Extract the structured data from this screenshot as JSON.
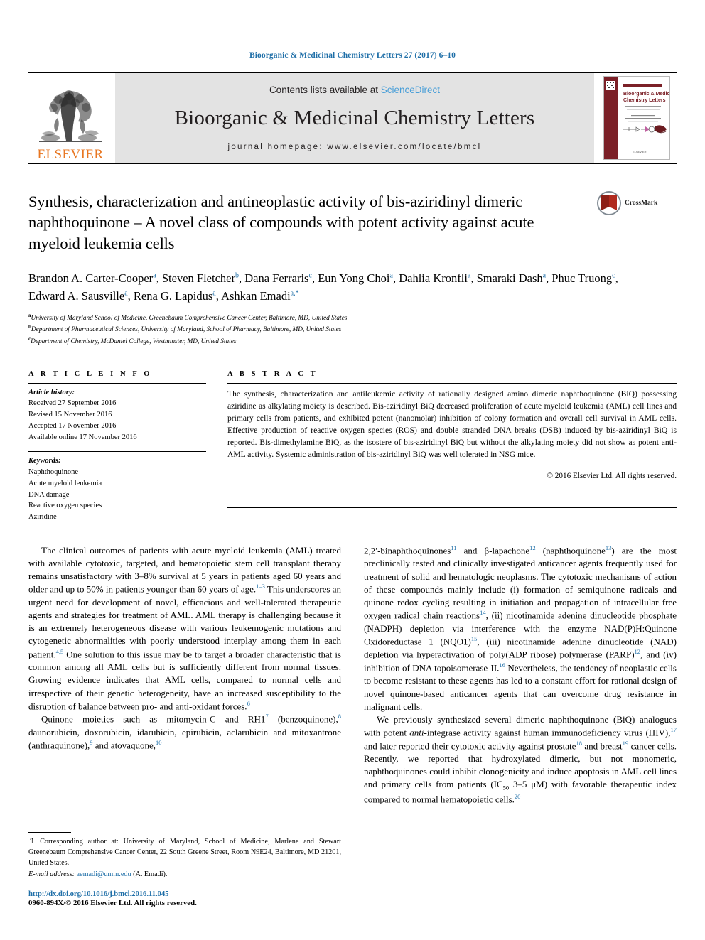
{
  "running_head": "Bioorganic & Medicinal Chemistry Letters 27 (2017) 6–10",
  "masthead": {
    "publisher": "ELSEVIER",
    "contents_prefix": "Contents lists available at ",
    "contents_link": "ScienceDirect",
    "journal_title": "Bioorganic & Medicinal Chemistry Letters",
    "homepage": "journal homepage: www.elsevier.com/locate/bmcl",
    "cover_title": "Bioorganic & Medicinal Chemistry Letters"
  },
  "badge": {
    "crossmark_label": "CrossMark"
  },
  "article": {
    "title": "Synthesis, characterization and antineoplastic activity of bis-aziridinyl dimeric naphthoquinone – A novel class of compounds with potent activity against acute myeloid leukemia cells",
    "authors": [
      {
        "name": "Brandon A. Carter-Cooper",
        "sup": "a"
      },
      {
        "name": "Steven Fletcher",
        "sup": "b"
      },
      {
        "name": "Dana Ferraris",
        "sup": "c"
      },
      {
        "name": "Eun Yong Choi",
        "sup": "a"
      },
      {
        "name": "Dahlia Kronfli",
        "sup": "a"
      },
      {
        "name": "Smaraki Dash",
        "sup": "a"
      },
      {
        "name": "Phuc Truong",
        "sup": "c"
      },
      {
        "name": "Edward A. Sausville",
        "sup": "a"
      },
      {
        "name": "Rena G. Lapidus",
        "sup": "a"
      },
      {
        "name": "Ashkan Emadi",
        "sup": "a,*"
      }
    ],
    "affiliations": [
      {
        "marker": "a",
        "text": "University of Maryland School of Medicine, Greenebaum Comprehensive Cancer Center, Baltimore, MD, United States"
      },
      {
        "marker": "b",
        "text": "Department of Pharmaceutical Sciences, University of Maryland, School of Pharmacy, Baltimore, MD, United States"
      },
      {
        "marker": "c",
        "text": "Department of Chemistry, McDaniel College, Westminster, MD, United States"
      }
    ]
  },
  "article_info": {
    "heading": "A R T I C L E   I N F O",
    "history_label": "Article history:",
    "history": [
      "Received 27 September 2016",
      "Revised 15 November 2016",
      "Accepted 17 November 2016",
      "Available online 17 November 2016"
    ],
    "keywords_label": "Keywords:",
    "keywords": [
      "Naphthoquinone",
      "Acute myeloid leukemia",
      "DNA damage",
      "Reactive oxygen species",
      "Aziridine"
    ]
  },
  "abstract": {
    "heading": "A B S T R A C T",
    "text": "The synthesis, characterization and antileukemic activity of rationally designed amino dimeric naphthoquinone (BiQ) possessing aziridine as alkylating moiety is described. Bis-aziridinyl BiQ decreased proliferation of acute myeloid leukemia (AML) cell lines and primary cells from patients, and exhibited potent (nanomolar) inhibition of colony formation and overall cell survival in AML cells. Effective production of reactive oxygen species (ROS) and double stranded DNA breaks (DSB) induced by bis-aziridinyl BiQ is reported. Bis-dimethylamine BiQ, as the isostere of bis-aziridinyl BiQ but without the alkylating moiety did not show as potent anti-AML activity. Systemic administration of bis-aziridinyl BiQ was well tolerated in NSG mice.",
    "copyright": "© 2016 Elsevier Ltd. All rights reserved."
  },
  "body": {
    "left": {
      "para1": "The clinical outcomes of patients with acute myeloid leukemia (AML) treated with available cytotoxic, targeted, and hematopoietic stem cell transplant therapy remains unsatisfactory with 3–8% survival at 5 years in patients aged 60 years and older and up to 50% in patients younger than 60 years of age.",
      "para1_ref1": "1–3",
      "para1_cont": " This underscores an urgent need for development of novel, efficacious and well-tolerated therapeutic agents and strategies for treatment of AML. AML therapy is challenging because it is an extremely heterogeneous disease with various leukemogenic mutations and cytogenetic abnormalities with poorly understood interplay among them in each patient.",
      "para1_ref2": "4,5",
      "para1_cont2": " One solution to this issue may be to target a broader characteristic that is common among all AML cells but is sufficiently different from normal tissues. Growing evidence indicates that AML cells, compared to normal cells and irrespective of their genetic heterogeneity, have an increased susceptibility to the disruption of balance between pro- and anti-oxidant forces.",
      "para1_ref3": "6",
      "para2_a": "Quinone moieties such as mitomycin-C and RH1",
      "para2_ref1": "7",
      "para2_b": " (benzoquinone),",
      "para2_ref2": "8",
      "para2_c": " daunorubicin, doxorubicin, idarubicin, epirubicin, aclarubicin and mitoxantrone (anthraquinone),",
      "para2_ref3": "9",
      "para2_d": " and atovaquone,",
      "para2_ref4": "10"
    },
    "right": {
      "p1_a": "2,2′-binaphthoquinones",
      "p1_r1": "11",
      "p1_b": " and β-lapachone",
      "p1_r2": "12",
      "p1_c": " (naphthoquinone",
      "p1_r3": "13",
      "p1_d": ") are the most preclinically tested and clinically investigated anticancer agents frequently used for treatment of solid and hematologic neoplasms. The cytotoxic mechanisms of action of these compounds mainly include (i) formation of semiquinone radicals and quinone redox cycling resulting in initiation and propagation of intracellular free oxygen radical chain reactions",
      "p1_r4": "14",
      "p1_e": ", (ii) nicotinamide adenine dinucleotide phosphate (NADPH) depletion via interference with the enzyme NAD(P)H:Quinone Oxidoreductase 1 (NQO1)",
      "p1_r5": "15",
      "p1_f": ", (iii) nicotinamide adenine dinucleotide (NAD) depletion via hyperactivation of poly(ADP ribose) polymerase (PARP)",
      "p1_r6": "12",
      "p1_g": ", and (iv) inhibition of DNA topoisomerase-II.",
      "p1_r7": "16",
      "p1_h": " Nevertheless, the tendency of neoplastic cells to become resistant to these agents has led to a constant effort for rational design of novel quinone-based anticancer agents that can overcome drug resistance in malignant cells.",
      "p2_a": "We previously synthesized several dimeric naphthoquinone (BiQ) analogues with potent ",
      "p2_italic": "anti",
      "p2_b": "-integrase activity against human immunodeficiency virus (HIV),",
      "p2_r1": "17",
      "p2_c": " and later reported their cytotoxic activity against prostate",
      "p2_r2": "18",
      "p2_d": " and breast",
      "p2_r3": "19",
      "p2_e": " cancer cells. Recently, we reported that hydroxylated dimeric, but not monomeric, naphthoquinones could inhibit clonogenicity and induce apoptosis in AML cell lines and primary cells from patients (IC",
      "p2_sub": "50",
      "p2_f": " 3–5 μM) with favorable therapeutic index compared to normal hematopoietic cells.",
      "p2_r4": "20"
    }
  },
  "footnotes": {
    "star": "⇑",
    "corresponding": " Corresponding author at: University of Maryland, School of Medicine, Marlene and Stewart Greenebaum Comprehensive Cancer Center, 22 South Greene Street, Room N9E24, Baltimore, MD 21201, United States.",
    "email_label": "E-mail address:",
    "email": "aemadi@umm.edu",
    "email_suffix": " (A. Emadi).",
    "doi": "http://dx.doi.org/10.1016/j.bmcl.2016.11.045",
    "issn": "0960-894X/© 2016 Elsevier Ltd. All rights reserved."
  },
  "colors": {
    "link_blue": "#1f6fa8",
    "sciencedirect_blue": "#4a9fd8",
    "elsevier_orange": "#E87722",
    "masthead_grey": "#e3e3e3"
  }
}
